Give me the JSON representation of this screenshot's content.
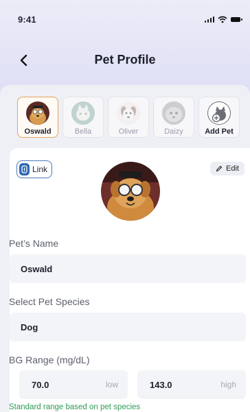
{
  "status_bar": {
    "time": "9:41"
  },
  "header": {
    "title": "Pet Profile"
  },
  "pets": [
    {
      "name": "Oswald",
      "active": true
    },
    {
      "name": "Bella",
      "active": false
    },
    {
      "name": "Oliver",
      "active": false
    },
    {
      "name": "Daizy",
      "active": false
    }
  ],
  "add_pet_label": "Add Pet",
  "profile": {
    "link_label": "Link",
    "edit_label": "Edit",
    "name_label": "Pet’s Name",
    "name_value": "Oswald",
    "species_label": "Select Pet Species",
    "species_value": "Dog",
    "bg_label": "BG Range (mg/dL)",
    "bg_low_value": "70.0",
    "bg_low_unit": "low",
    "bg_high_value": "143.0",
    "bg_high_unit": "high",
    "hint": "Standard range based on pet species"
  },
  "colors": {
    "accent": "#2f67b4",
    "active_border": "#e6a25a",
    "hint": "#2f9a55"
  }
}
